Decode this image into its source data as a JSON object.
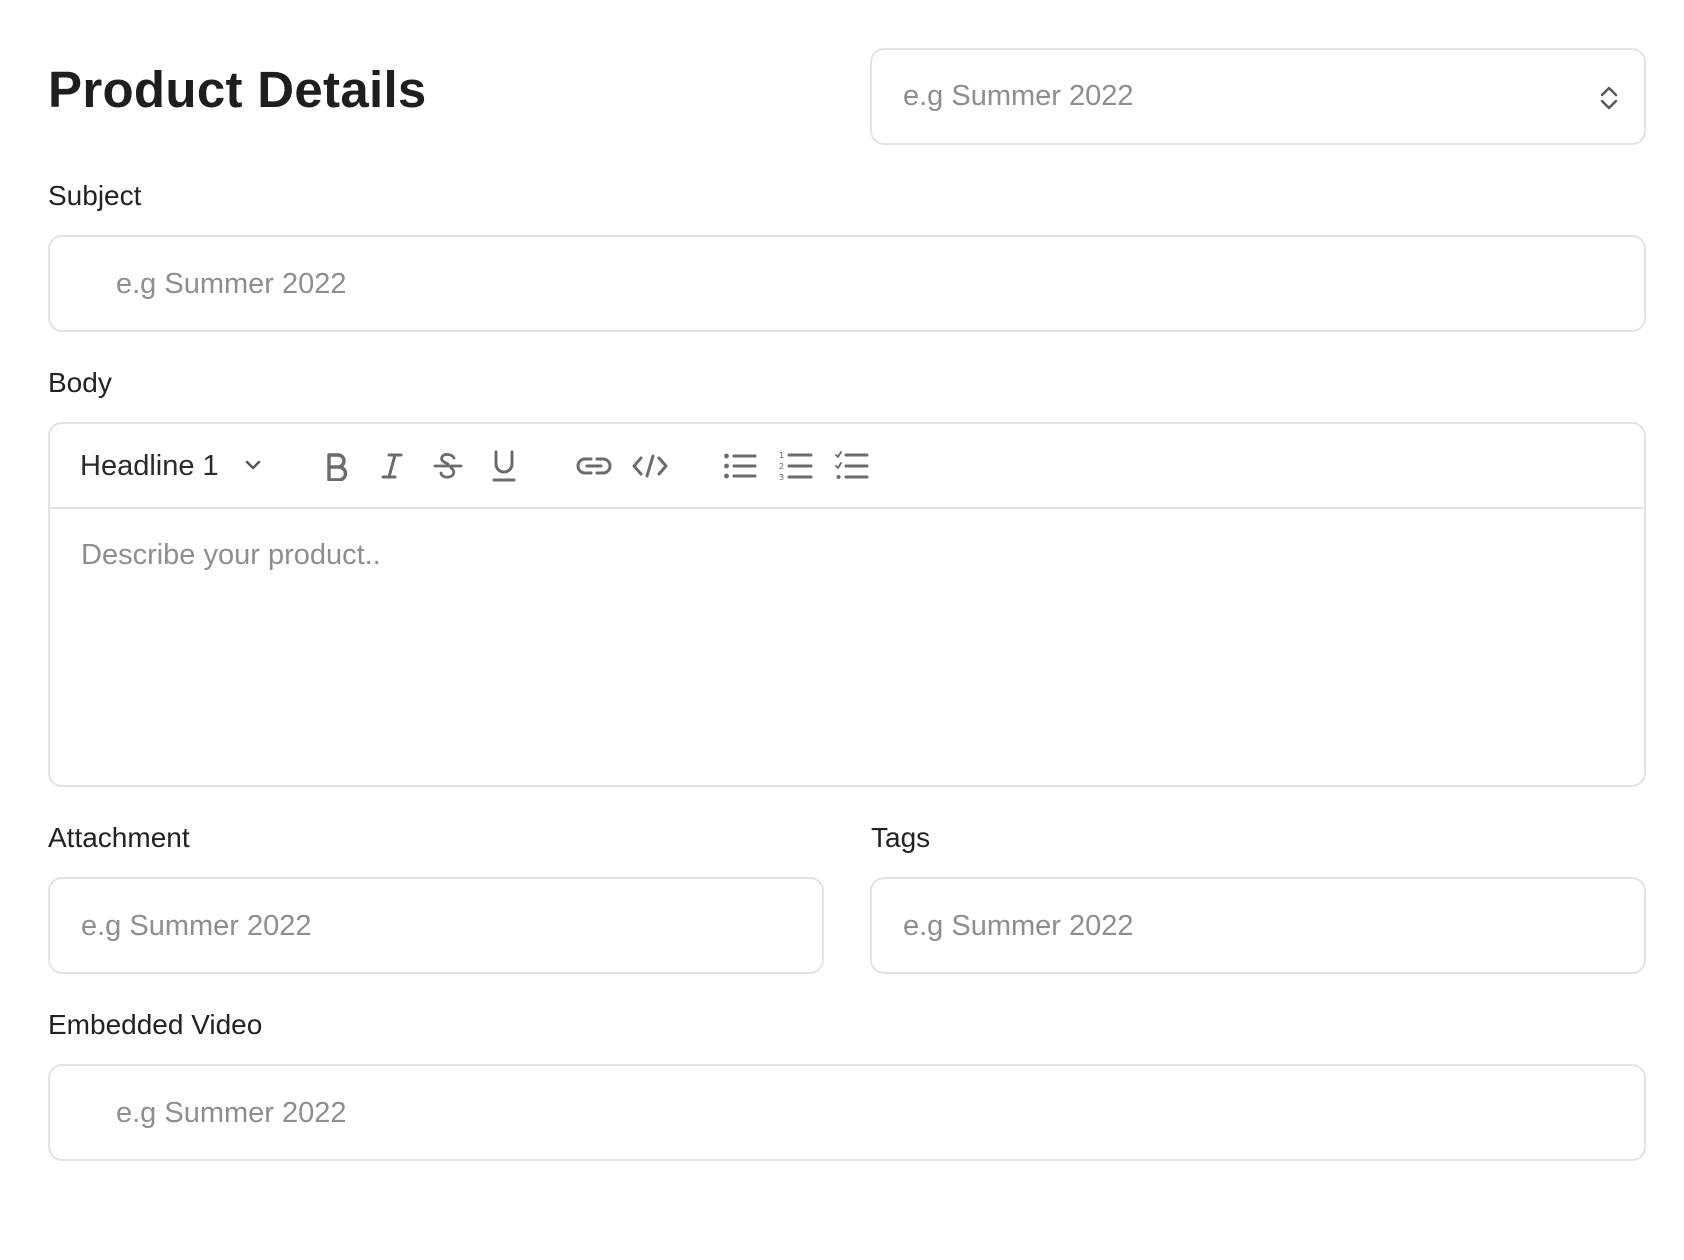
{
  "header": {
    "title": "Product Details",
    "select_placeholder": "e.g Summer 2022"
  },
  "subject": {
    "label": "Subject",
    "placeholder": "e.g Summer 2022"
  },
  "body": {
    "label": "Body",
    "toolbar": {
      "heading_select": "Headline 1",
      "icons": [
        "bold-icon",
        "italic-icon",
        "strikethrough-icon",
        "underline-icon",
        "link-icon",
        "code-icon",
        "bullet-list-icon",
        "numbered-list-icon",
        "checklist-icon"
      ]
    },
    "placeholder": "Describe your product.."
  },
  "attachment": {
    "label": "Attachment",
    "placeholder": "e.g Summer 2022"
  },
  "tags": {
    "label": "Tags",
    "placeholder": "e.g Summer 2022"
  },
  "embedded_video": {
    "label": "Embedded Video",
    "placeholder": "e.g Summer 2022"
  }
}
